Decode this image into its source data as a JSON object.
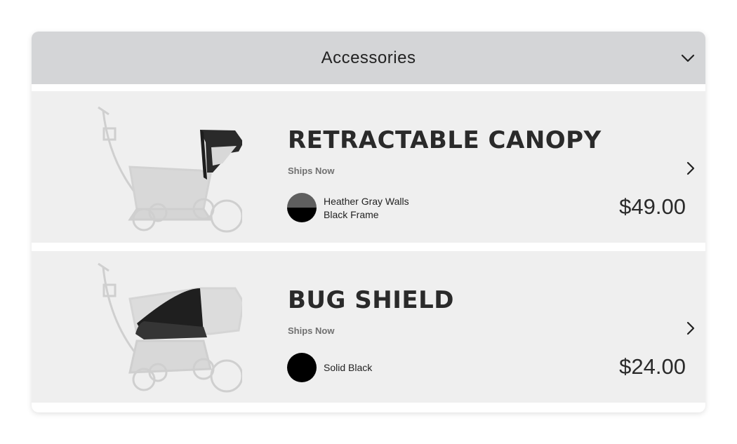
{
  "accordion": {
    "title": "Accessories",
    "toggle_icon": "chevron-down-icon"
  },
  "products": [
    {
      "name": "RETRACTABLE CANOPY",
      "availability": "Ships Now",
      "color_line_1": "Heather Gray Walls",
      "color_line_2": "Black Frame",
      "price": "$49.00",
      "swatch_colors": [
        "#5f5f5f",
        "#000000"
      ],
      "arrow_icon": "chevron-right-icon"
    },
    {
      "name": "BUG SHIELD",
      "availability": "Ships Now",
      "color_line_1": "Solid Black",
      "price": "$24.00",
      "swatch_colors": [
        "#000000"
      ],
      "arrow_icon": "chevron-right-icon"
    }
  ],
  "colors": {
    "header_bg": "#d4d5d7",
    "card_bg": "#efefef",
    "text_dark": "#2a2a2a"
  }
}
